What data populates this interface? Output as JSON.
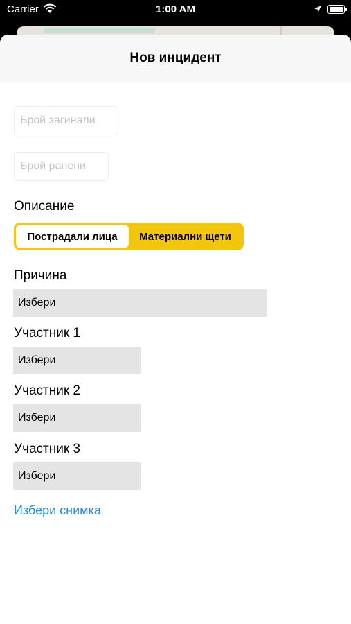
{
  "status_bar": {
    "carrier": "Carrier",
    "time": "1:00 AM"
  },
  "nav": {
    "title": "Нов инцидент"
  },
  "fields": {
    "deaths_placeholder": "Брой загинали",
    "injured_placeholder": "Брой ранени"
  },
  "description": {
    "label": "Описание",
    "segments": [
      "Пострадали лица",
      "Материални щети"
    ],
    "selected": "Пострадали лица"
  },
  "cause": {
    "label": "Причина",
    "value": "Избери"
  },
  "participants": [
    {
      "label": "Участник 1",
      "value": "Избери"
    },
    {
      "label": "Участник 2",
      "value": "Избери"
    },
    {
      "label": "Участник 3",
      "value": "Избери"
    }
  ],
  "photo_link": "Избери снимка",
  "colors": {
    "accent": "#f2c50e",
    "link": "#1e8ee6",
    "picker_bg": "#e4e4e4"
  }
}
